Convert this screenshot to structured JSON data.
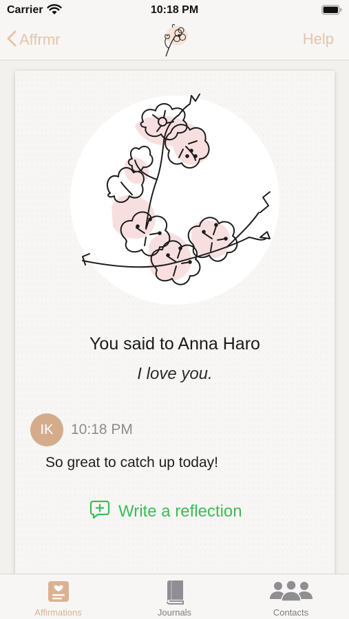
{
  "status_bar": {
    "carrier": "Carrier",
    "time": "10:18 PM",
    "icons": [
      "wifi-icon",
      "battery-icon"
    ]
  },
  "nav": {
    "back_label": "Affrmr",
    "help_label": "Help",
    "logo_icon": "flower-logo-icon"
  },
  "card": {
    "illustration": "cherry-blossom-illustration",
    "said_to": "You said to Anna Haro",
    "affirmation": "I love you.",
    "message": {
      "avatar_initials": "IK",
      "time": "10:18 PM",
      "text": "So great to catch up today!"
    },
    "reflection_button": "Write a reflection"
  },
  "tabs": [
    {
      "label": "Affirmations",
      "icon": "affirmations-icon",
      "active": true
    },
    {
      "label": "Journals",
      "icon": "book-icon",
      "active": false
    },
    {
      "label": "Contacts",
      "icon": "people-icon",
      "active": false
    }
  ],
  "colors": {
    "accent": "#e4c4a8",
    "tab_active": "#d9b292",
    "avatar": "#d4ac8c",
    "reflection_green": "#3dbb57"
  }
}
